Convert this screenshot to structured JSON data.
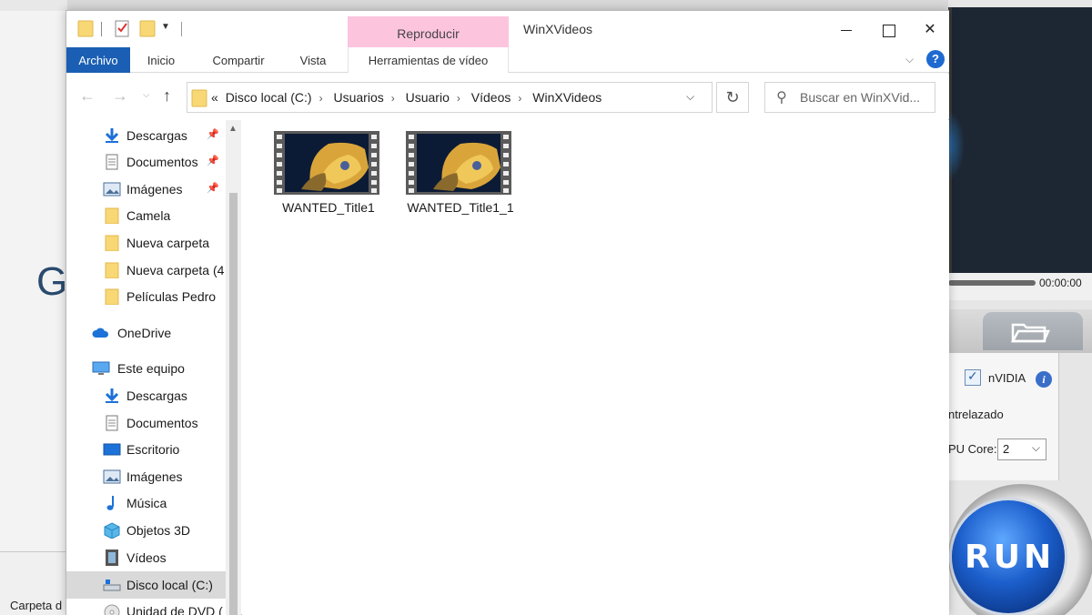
{
  "background_app": {
    "left_letter": "G",
    "status_text": "Carpeta d",
    "time_readout": "00:00:00",
    "gpu_label": "nVIDIA",
    "gpu_checked": true,
    "deinterlace_label": "ntrelazado",
    "cpu_core_label": "PU Core:",
    "cpu_core_value": "2",
    "run_label": "RUN"
  },
  "window": {
    "title": "WinXVideos",
    "context_tab_header": "Reproducir",
    "ribbon_tabs": [
      "Archivo",
      "Inicio",
      "Compartir",
      "Vista",
      "Herramientas de vídeo"
    ],
    "accent_color": "#1a5fb4",
    "context_color": "#fdc4de"
  },
  "address_bar": {
    "overflow": "«",
    "crumbs": [
      "Disco local (C:)",
      "Usuarios",
      "Usuario",
      "Vídeos",
      "WinXVideos"
    ]
  },
  "search": {
    "placeholder": "Buscar en WinXVid..."
  },
  "nav_pane": {
    "items": [
      {
        "label": "Descargas",
        "icon": "download-arrow-icon",
        "pinned": true
      },
      {
        "label": "Documentos",
        "icon": "document-icon",
        "pinned": true
      },
      {
        "label": "Imágenes",
        "icon": "pictures-icon",
        "pinned": true
      },
      {
        "label": "Camela",
        "icon": "folder-icon",
        "pinned": false
      },
      {
        "label": "Nueva carpeta",
        "icon": "folder-icon",
        "pinned": false
      },
      {
        "label": "Nueva carpeta (4",
        "icon": "folder-icon",
        "pinned": false
      },
      {
        "label": "Películas Pedro",
        "icon": "folder-icon",
        "pinned": false
      },
      {
        "label": "OneDrive",
        "icon": "cloud-icon",
        "pinned": false
      },
      {
        "label": "Este equipo",
        "icon": "computer-icon",
        "pinned": false
      },
      {
        "label": "Descargas",
        "icon": "download-arrow-icon",
        "pinned": false
      },
      {
        "label": "Documentos",
        "icon": "document-icon",
        "pinned": false
      },
      {
        "label": "Escritorio",
        "icon": "desktop-icon",
        "pinned": false
      },
      {
        "label": "Imágenes",
        "icon": "pictures-icon",
        "pinned": false
      },
      {
        "label": "Música",
        "icon": "music-note-icon",
        "pinned": false
      },
      {
        "label": "Objetos 3D",
        "icon": "cube-3d-icon",
        "pinned": false
      },
      {
        "label": "Vídeos",
        "icon": "video-film-icon",
        "pinned": false
      },
      {
        "label": "Disco local (C:)",
        "icon": "hard-drive-icon",
        "pinned": false,
        "selected": true
      },
      {
        "label": "Unidad de DVD (",
        "icon": "dvd-drive-icon",
        "pinned": false
      }
    ]
  },
  "files": [
    {
      "name": "WANTED_Title1",
      "type": "video"
    },
    {
      "name": "WANTED_Title1_1",
      "type": "video"
    }
  ]
}
